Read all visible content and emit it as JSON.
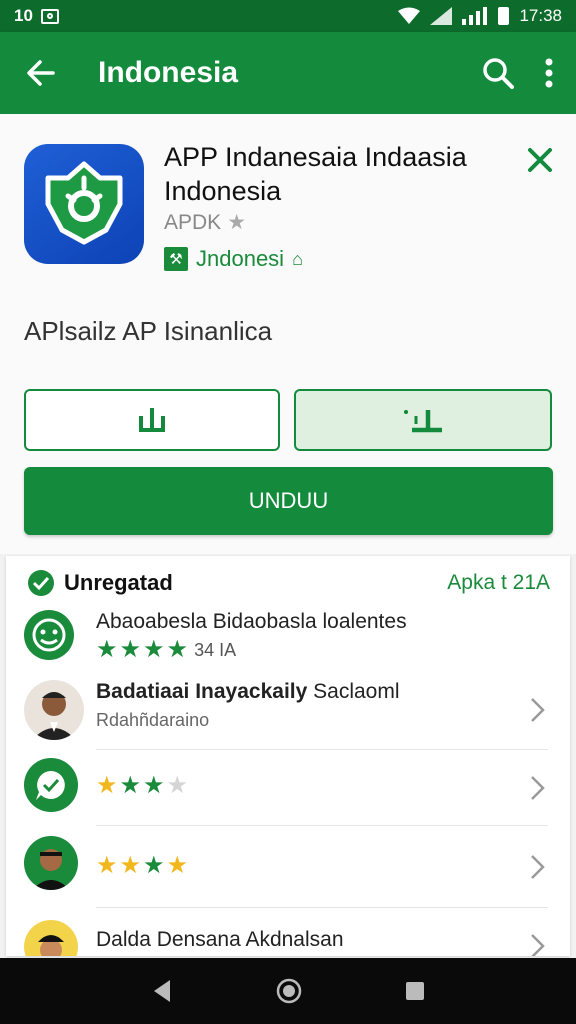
{
  "status_bar": {
    "left_text": "10",
    "time": "17:38"
  },
  "app_bar": {
    "title": "Indonesia"
  },
  "app": {
    "name": "APP Indanesaia Indaasia Indonesia",
    "apk_label": "APDK",
    "developer": "Jndonesi",
    "description": "APlsailz AP Isinanlica",
    "install_label": "UNDUU"
  },
  "list": {
    "title": "Unregatad",
    "more": "Apka t 21A",
    "rows": [
      {
        "title": "Abaoabesla Bidaobasla loalentes",
        "rating_text": "34 IA"
      },
      {
        "title": "Badatiaai Inayackaily",
        "title_right": "Saclaoml",
        "subtitle": "Rdahñdaraino"
      },
      {
        "title": ""
      },
      {
        "title": ""
      },
      {
        "title": "Dalda Densana Akdnalsan"
      }
    ]
  },
  "colors": {
    "primary": "#138a3c",
    "primary_dark": "#0d6b2c",
    "star": "#f2b71c"
  }
}
